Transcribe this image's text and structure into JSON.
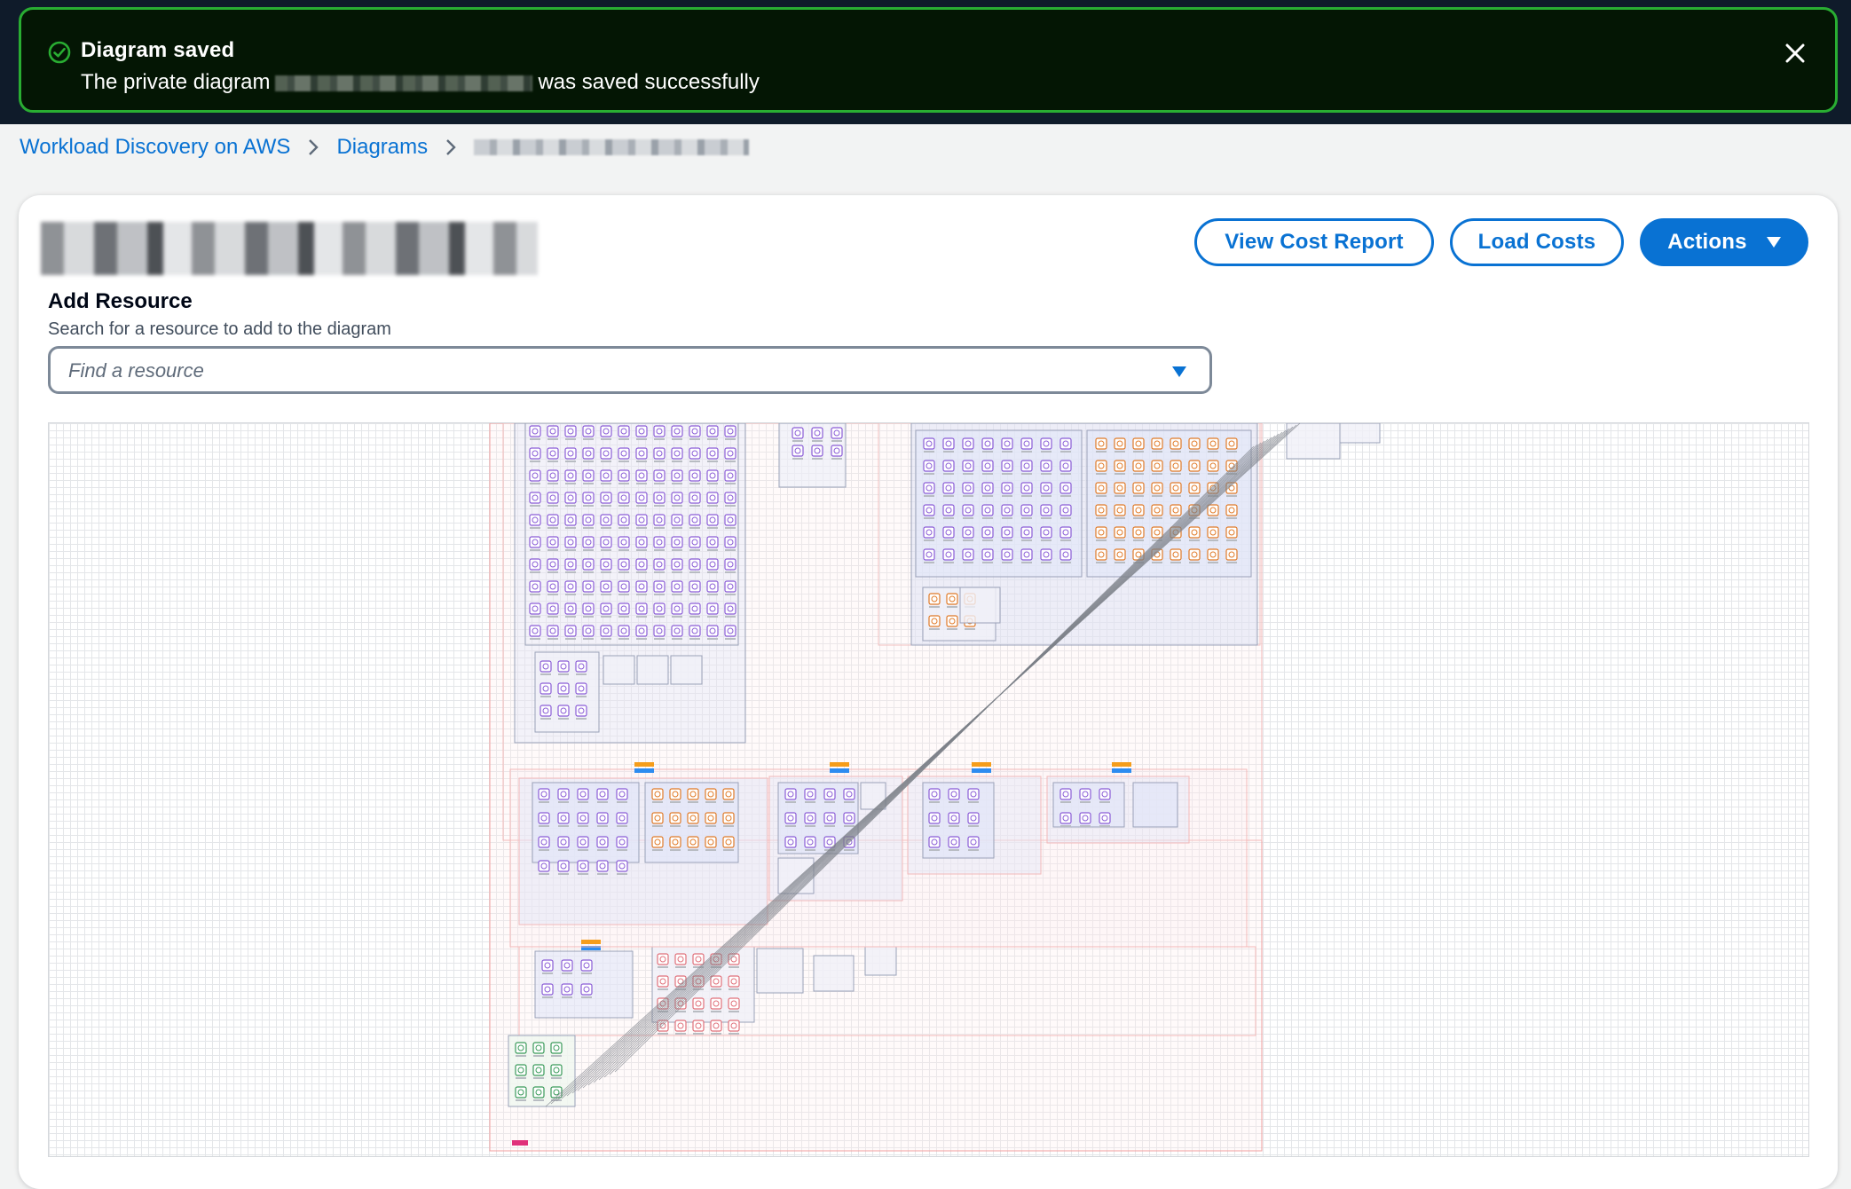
{
  "flash": {
    "title": "Diagram saved",
    "message_prefix": "The private diagram",
    "message_suffix": "was saved successfully",
    "status_color": "#29ad32",
    "icon": "check-circle-icon",
    "close_icon": "close-icon"
  },
  "breadcrumb": {
    "items": [
      "Workload Discovery on AWS",
      "Diagrams"
    ],
    "separator_icon": "chevron-right-icon"
  },
  "header": {
    "buttons": {
      "view_cost_report": "View Cost Report",
      "load_costs": "Load Costs",
      "actions": "Actions"
    }
  },
  "add_resource": {
    "title": "Add Resource",
    "description": "Search for a resource to add to the diagram",
    "placeholder": "Find a resource"
  },
  "colors": {
    "primary": "#0972d3",
    "banner_bg": "#041604",
    "page_bg": "#f2f3f3"
  }
}
